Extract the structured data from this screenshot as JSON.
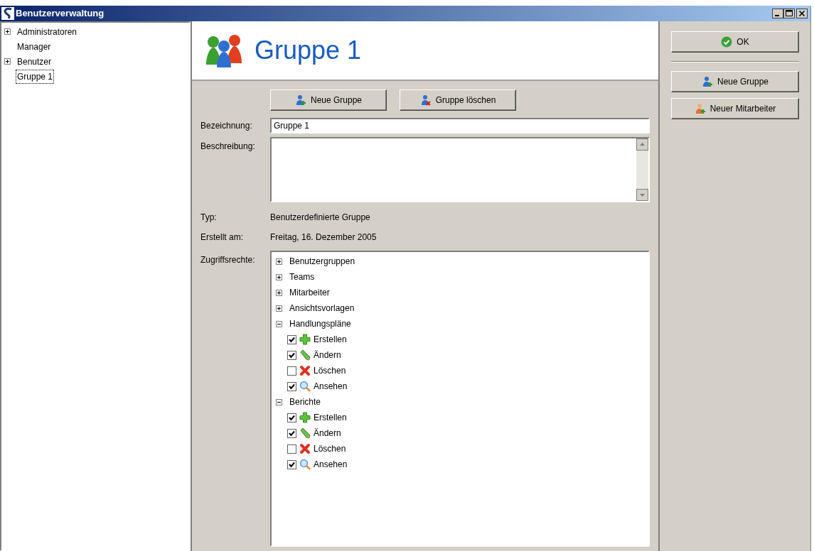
{
  "window": {
    "title": "Benutzerverwaltung"
  },
  "sidebar": {
    "items": [
      {
        "label": "Administratoren",
        "kind": "group",
        "selected": false
      },
      {
        "label": "Manager",
        "kind": "leaf",
        "selected": false
      },
      {
        "label": "Benutzer",
        "kind": "group",
        "selected": false
      },
      {
        "label": "Gruppe 1",
        "kind": "leaf",
        "selected": true
      }
    ]
  },
  "header": {
    "title": "Gruppe 1"
  },
  "toolbar": [
    {
      "label": "Neue Gruppe",
      "kind": "add"
    },
    {
      "label": "Gruppe löschen",
      "kind": "delete"
    }
  ],
  "form": {
    "name_label": "Bezeichnung:",
    "name_value": "Gruppe 1",
    "description_label": "Beschreibung:",
    "type_label": "Typ:",
    "type_value": "Benutzerdefinierte Gruppe",
    "created_label": "Erstellt am:",
    "created_value": "Freitag, 16. Dezember 2005",
    "rights_label": "Zugriffsrechte:"
  },
  "rights": [
    {
      "label": "Benutzergruppen",
      "expanded": false
    },
    {
      "label": "Teams",
      "expanded": false
    },
    {
      "label": "Mitarbeiter",
      "expanded": false
    },
    {
      "label": "Ansichtsvorlagen",
      "expanded": false
    },
    {
      "label": "Handlungspläne",
      "expanded": true,
      "children": [
        {
          "label": "Erstellen",
          "kind": "create",
          "checked": true
        },
        {
          "label": "Ändern",
          "kind": "edit",
          "checked": true
        },
        {
          "label": "Löschen",
          "kind": "delete",
          "checked": false
        },
        {
          "label": "Ansehen",
          "kind": "view",
          "checked": true
        }
      ]
    },
    {
      "label": "Berichte",
      "expanded": true,
      "children": [
        {
          "label": "Erstellen",
          "kind": "create",
          "checked": true
        },
        {
          "label": "Ändern",
          "kind": "edit",
          "checked": true
        },
        {
          "label": "Löschen",
          "kind": "delete",
          "checked": false
        },
        {
          "label": "Ansehen",
          "kind": "view",
          "checked": true
        }
      ]
    }
  ],
  "actions": [
    {
      "label": "OK",
      "kind": "ok"
    },
    {
      "label": "Neue Gruppe",
      "kind": "add-group"
    },
    {
      "label": "Neuer Mitarbeiter",
      "kind": "add-person"
    }
  ]
}
